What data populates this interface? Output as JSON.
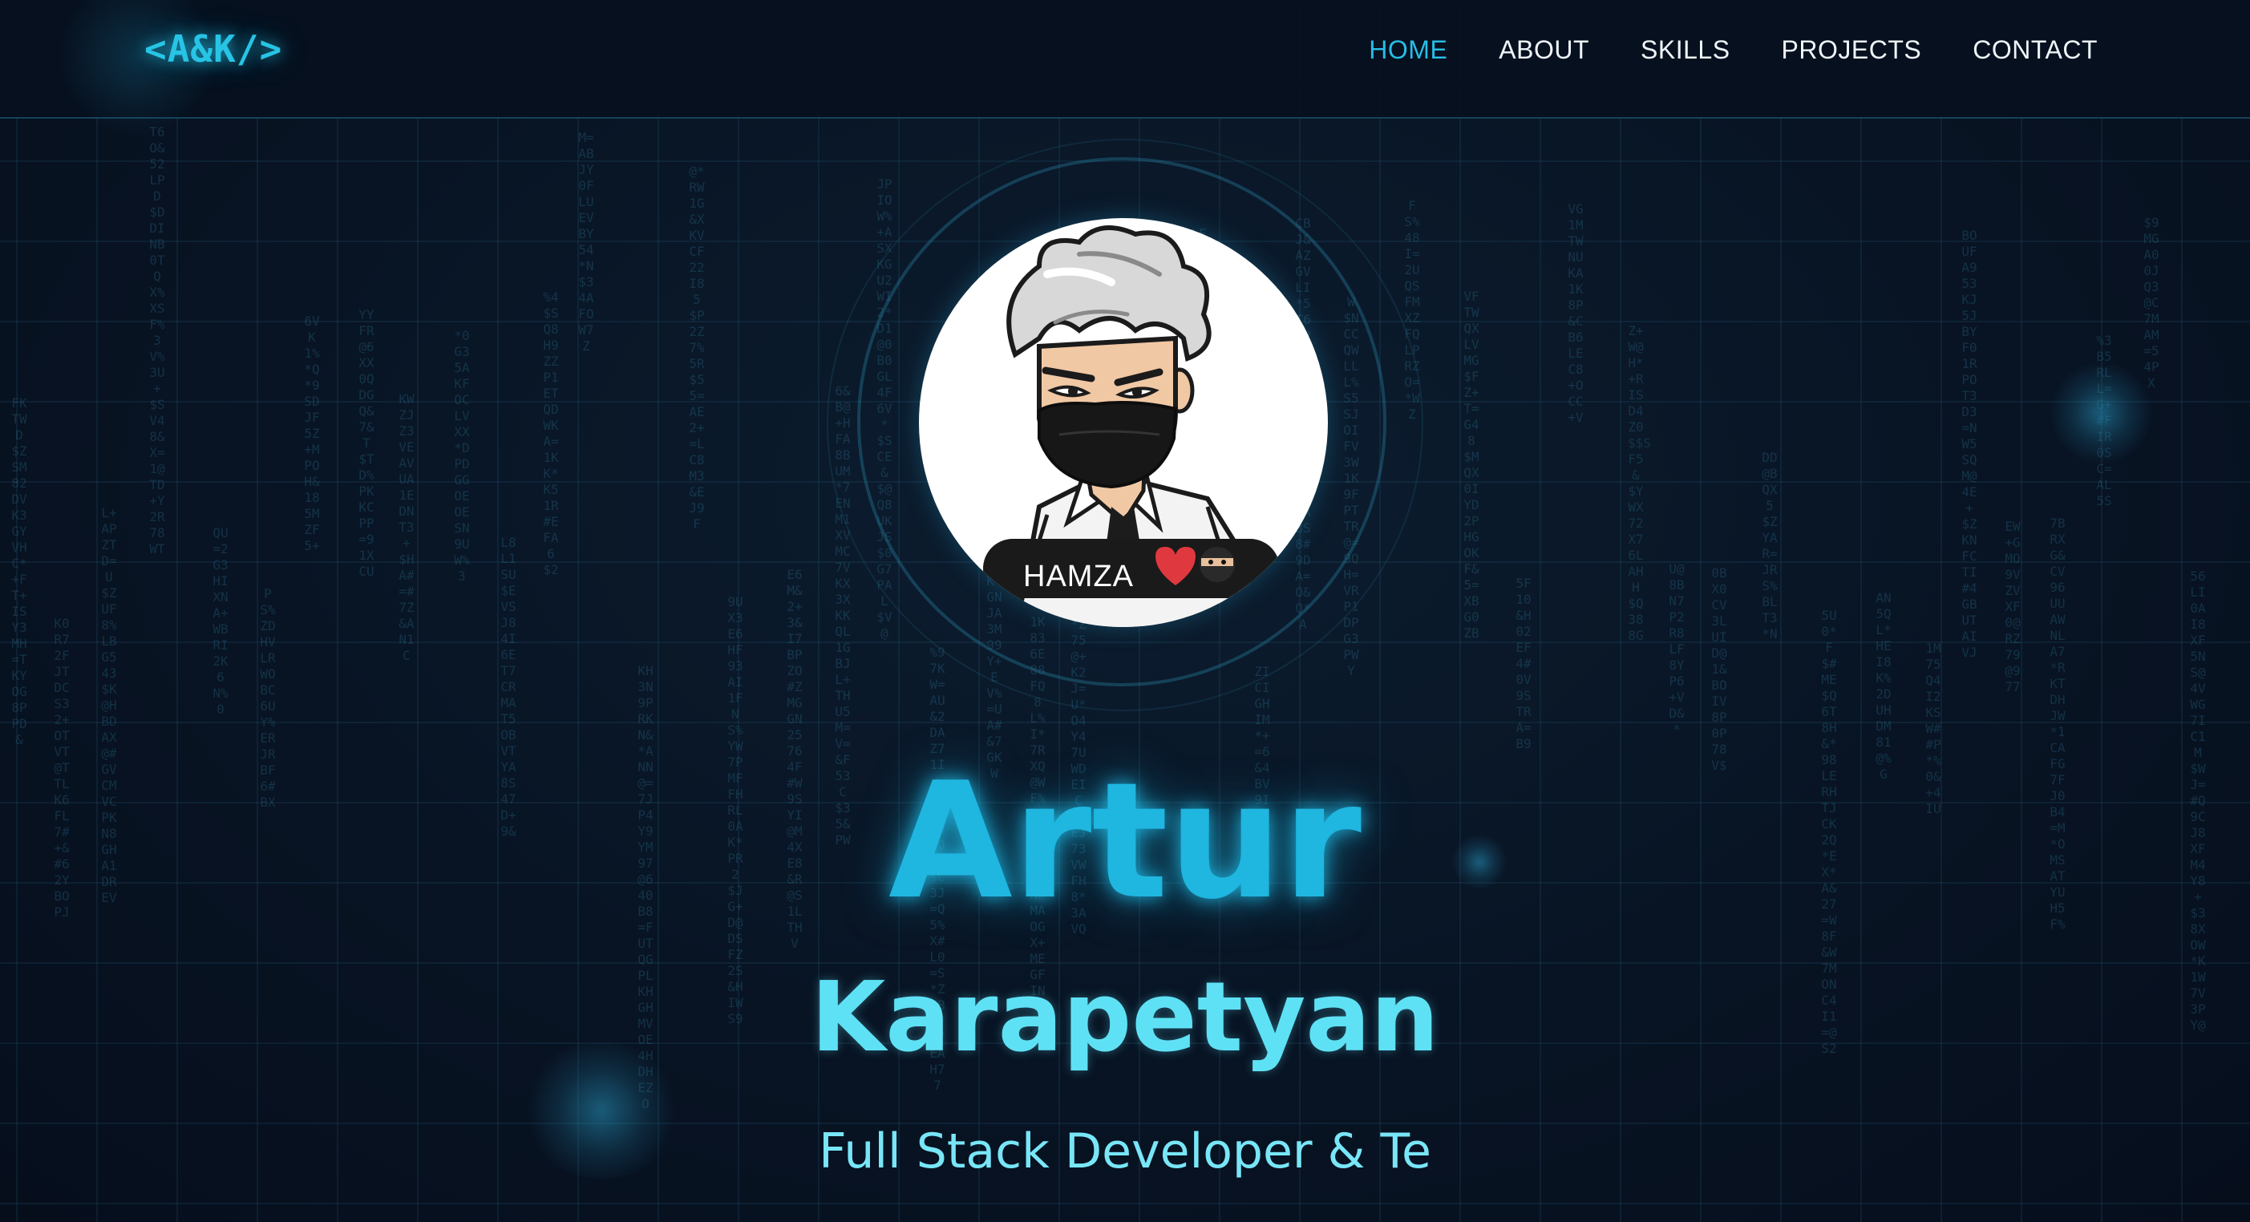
{
  "logo": {
    "text": "<A&K/>"
  },
  "nav": {
    "items": [
      {
        "label": "HOME",
        "active": true
      },
      {
        "label": "ABOUT",
        "active": false
      },
      {
        "label": "SKILLS",
        "active": false
      },
      {
        "label": "PROJECTS",
        "active": false
      },
      {
        "label": "CONTACT",
        "active": false
      }
    ]
  },
  "avatar": {
    "badge_label": "HAMZA"
  },
  "hero": {
    "first_name": "Artur",
    "last_name": "Karapetyan",
    "subtitle": "Full Stack Developer & Te"
  },
  "colors": {
    "background": "#081222",
    "accent": "#28bde6",
    "accent_light": "#5fe1f5",
    "nav_text": "#eef4f8"
  },
  "icons": [
    "avatar-illustration",
    "heart-emoji-icon",
    "ninja-emoji-icon"
  ]
}
